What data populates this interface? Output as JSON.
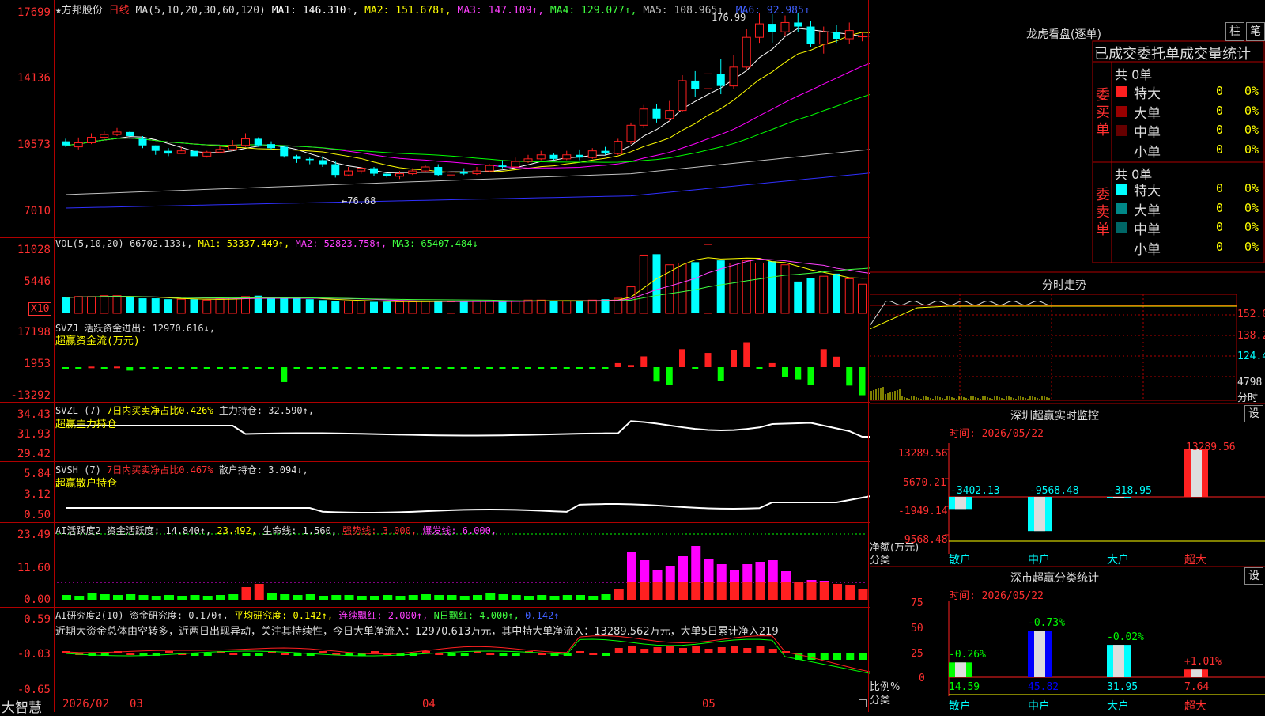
{
  "app": {
    "name": "大智慧"
  },
  "stock": {
    "name": "★方邦股份",
    "period": "日线"
  },
  "main": {
    "ma_label": "MA(5,10,20,30,60,120)",
    "ma1": "MA1: 146.310↑,",
    "ma2": "MA2: 151.678↑,",
    "ma3": "MA3: 147.109↑,",
    "ma4": "MA4: 129.077↑,",
    "ma5": "MA5: 108.965↑,",
    "ma6": "MA6: 92.985↑",
    "yticks": [
      "17699",
      "14136",
      "10573",
      "7010"
    ],
    "high_mark": "176.99",
    "low_mark": "←76.68",
    "colors": {
      "ma1": "#ffffff",
      "ma2": "#ffff00",
      "ma3": "#ff00ff",
      "ma4": "#00ff00",
      "ma5": "#c0c0c0",
      "ma6": "#3030ff",
      "up": "#ff2020",
      "down": "#00ffff"
    }
  },
  "candles": [
    [
      106.6,
      104.4,
      108.0,
      103.6
    ],
    [
      103.6,
      105.8,
      108.7,
      102.2
    ],
    [
      105.8,
      108.8,
      111.0,
      105.1
    ],
    [
      108.8,
      110.3,
      112.5,
      107.3
    ],
    [
      110.3,
      111.7,
      113.9,
      109.5
    ],
    [
      111.7,
      109.5,
      112.5,
      108.0
    ],
    [
      108.0,
      104.4,
      109.5,
      102.9
    ],
    [
      104.4,
      101.4,
      104.4,
      99.2
    ],
    [
      101.4,
      99.9,
      102.9,
      98.5
    ],
    [
      99.9,
      101.4,
      103.6,
      99.9
    ],
    [
      101.4,
      98.5,
      102.2,
      96.3
    ],
    [
      98.5,
      100.7,
      101.4,
      97.7
    ],
    [
      100.7,
      102.2,
      104.4,
      100.0
    ],
    [
      102.2,
      104.4,
      107.3,
      101.4
    ],
    [
      104.4,
      108.0,
      111.0,
      103.6
    ],
    [
      108.0,
      104.4,
      108.8,
      103.6
    ],
    [
      105.1,
      102.9,
      106.6,
      102.2
    ],
    [
      103.6,
      98.5,
      104.4,
      97.7
    ],
    [
      98.5,
      97.0,
      99.2,
      94.8
    ],
    [
      97.0,
      96.3,
      97.7,
      94.1
    ],
    [
      96.3,
      94.1,
      98.5,
      92.6
    ],
    [
      94.1,
      88.2,
      95.6,
      86.8
    ],
    [
      88.2,
      90.4,
      92.6,
      87.5
    ],
    [
      90.4,
      91.9,
      92.6,
      88.9
    ],
    [
      91.9,
      88.9,
      92.6,
      87.5
    ],
    [
      88.9,
      87.5,
      89.7,
      86.8
    ],
    [
      87.5,
      88.9,
      90.4,
      86.0
    ],
    [
      88.9,
      90.4,
      91.9,
      88.2
    ],
    [
      90.4,
      92.6,
      93.4,
      89.7
    ],
    [
      92.6,
      88.2,
      94.1,
      87.5
    ],
    [
      88.2,
      89.7,
      90.4,
      87.5
    ],
    [
      89.7,
      88.9,
      91.9,
      88.2
    ],
    [
      88.9,
      90.4,
      92.6,
      88.2
    ],
    [
      90.4,
      93.4,
      94.1,
      89.7
    ],
    [
      93.4,
      92.6,
      96.3,
      91.9
    ],
    [
      92.6,
      95.6,
      97.7,
      91.9
    ],
    [
      95.6,
      97.0,
      99.2,
      94.8
    ],
    [
      97.0,
      99.2,
      101.4,
      96.3
    ],
    [
      99.2,
      97.0,
      99.9,
      96.3
    ],
    [
      97.0,
      99.2,
      101.4,
      96.3
    ],
    [
      99.2,
      97.7,
      102.2,
      96.3
    ],
    [
      97.7,
      101.4,
      102.9,
      97.0
    ],
    [
      101.4,
      99.9,
      103.6,
      99.2
    ],
    [
      99.9,
      106.6,
      108.0,
      99.2
    ],
    [
      106.6,
      115.4,
      116.9,
      105.1
    ],
    [
      115.4,
      124.3,
      126.5,
      113.9
    ],
    [
      124.3,
      119.1,
      127.2,
      116.9
    ],
    [
      119.1,
      123.5,
      128.7,
      117.7
    ],
    [
      123.5,
      139.8,
      142.8,
      122.8
    ],
    [
      139.8,
      135.4,
      145.0,
      131.0
    ],
    [
      135.4,
      143.5,
      146.5,
      131.7
    ],
    [
      143.5,
      136.9,
      151.6,
      132.4
    ],
    [
      136.9,
      147.2,
      153.8,
      135.4
    ],
    [
      147.2,
      163.5,
      167.9,
      145.7
    ],
    [
      163.5,
      170.9,
      176.8,
      160.5
    ],
    [
      170.9,
      166.5,
      176.2,
      160.6
    ],
    [
      166.5,
      171.6,
      175.4,
      164.2
    ],
    [
      171.6,
      169.4,
      176.9,
      166.5
    ],
    [
      169.4,
      159.8,
      172.4,
      158.3
    ],
    [
      159.8,
      166.5,
      169.4,
      154.6
    ],
    [
      166.5,
      162.7,
      170.1,
      160.5
    ],
    [
      162.7,
      167.2,
      171.6,
      159.8
    ],
    [
      164.2,
      164.2,
      166.5,
      161.3
    ],
    [
      166.5,
      160.5,
      168.7,
      158.3
    ],
    [
      160.5,
      151.6,
      162.7,
      149.4
    ],
    [
      151.6,
      147.2,
      155.3,
      144.3
    ],
    [
      147.2,
      148.7,
      151.6,
      143.5
    ],
    [
      148.7,
      149.4,
      152.3,
      146.5
    ],
    [
      149.4,
      142.8,
      153.1,
      142.8
    ],
    [
      142.8,
      163.5,
      164.2,
      142.8
    ]
  ],
  "vol": {
    "label": "VOL(5,10,20)",
    "v": "66702.133↓,",
    "ma1": "MA1: 53337.449↑,",
    "ma2": "MA2: 52823.758↑,",
    "ma3": "MA3: 65407.484↓",
    "yticks": [
      "11028",
      "5446"
    ],
    "unit": "X10",
    "values": [
      18,
      19,
      19,
      20,
      20,
      18,
      17,
      17,
      16,
      16,
      16,
      15,
      16,
      17,
      19,
      20,
      18,
      17,
      17,
      16,
      15,
      14,
      14,
      14,
      13,
      13,
      13,
      13,
      14,
      14,
      13,
      13,
      14,
      14,
      13,
      14,
      15,
      15,
      14,
      14,
      14,
      15,
      16,
      17,
      30,
      66,
      67,
      55,
      57,
      58,
      78,
      60,
      57,
      60,
      57,
      59,
      55,
      36,
      40,
      42,
      45,
      39,
      33,
      41,
      36,
      30,
      31,
      35,
      48,
      46
    ]
  },
  "svzj": {
    "label": "SVZJ  活跃资金进出: 12970.616↓,",
    "sub": "超赢资金流(万元)",
    "yticks": [
      "17198",
      "1953",
      "-13292"
    ],
    "values": [
      -800,
      -600,
      200,
      -500,
      200,
      -1300,
      -600,
      -400,
      -400,
      -300,
      -500,
      -300,
      -300,
      -400,
      -300,
      -600,
      -600,
      -5600,
      -300,
      -400,
      -400,
      -300,
      -300,
      -300,
      -300,
      -400,
      -200,
      -300,
      -200,
      -400,
      -300,
      -300,
      -300,
      -200,
      -300,
      -300,
      -200,
      -300,
      -300,
      -400,
      -300,
      -400,
      -300,
      1500,
      800,
      4000,
      -5400,
      -6500,
      6700,
      -200,
      5300,
      -5100,
      6300,
      9300,
      -300,
      1500,
      -3700,
      -4600,
      -6800,
      6700,
      3900,
      -6900,
      -10500,
      -5500,
      -4800,
      -1800,
      3100,
      12900,
      10400
    ]
  },
  "svzl": {
    "label": "SVZL (7)",
    "pct": "7日内买卖净占比0.426%",
    "hold": "主力持仓: 32.590↑,",
    "sub": "超赢主力持仓",
    "yticks": [
      "34.43",
      "31.93",
      "29.42"
    ]
  },
  "svsh": {
    "label": "SVSH (7)",
    "pct": "7日内买卖净占比0.467%",
    "hold": "散户持仓: 3.094↓,",
    "sub": "超赢散户持仓",
    "yticks": [
      "5.84",
      "3.12",
      "0.50"
    ]
  },
  "ai1": {
    "label": "AI活跃度2",
    "a": "资金活跃度: 14.840↑,",
    "b": "23.492,",
    "c": "生命线: 1.560,",
    "d": "强势线: 3.000,",
    "e": "爆发线: 6.000,",
    "yticks": [
      "23.49",
      "11.60",
      "0.00"
    ]
  },
  "ai2": {
    "label": "AI研究度2(10)",
    "a": "资金研究度: 0.170↑,",
    "b": "平均研究度: 0.142↑,",
    "c": "连续飘红: 2.000↑,",
    "d": "N日飘红: 4.000↑,",
    "e": "0.142↑",
    "note": "近期大资金总体由空转多，近两日出现异动，关注其持续性，今日大单净流入：12970.613万元，其中特大单净流入：13289.562万元，大单5日累计净入219",
    "yticks": [
      "0.59",
      "-0.03",
      "-0.65"
    ]
  },
  "timeaxis": [
    "2026/02",
    "03",
    "04",
    "05"
  ],
  "lhb": {
    "title": "龙虎看盘(逐单)",
    "btn1": "柱",
    "btn2": "笔",
    "header": "已成交委托单成交量统计",
    "buy_label": "委买单",
    "sell_label": "委卖单",
    "buy_total": "共 0单",
    "sell_total": "共 0单",
    "buy_rows": [
      [
        "特大",
        "0",
        "0%"
      ],
      [
        "大单",
        "0",
        "0%"
      ],
      [
        "中单",
        "0",
        "0%"
      ],
      [
        "小单",
        "0",
        "0%"
      ]
    ],
    "sell_rows": [
      [
        "特大",
        "0",
        "0%"
      ],
      [
        "大单",
        "0",
        "0%"
      ],
      [
        "中单",
        "0",
        "0%"
      ],
      [
        "小单",
        "0",
        "0%"
      ]
    ]
  },
  "fenshi": {
    "title": "分时走势",
    "yticks": [
      "152.0",
      "138.2",
      "124.4",
      "4798"
    ],
    "unit": "分时"
  },
  "szmon": {
    "title": "深圳超赢实时监控",
    "btn": "设",
    "time": "时间: 2026/05/22",
    "yticks": [
      "13289.56",
      "5670.21",
      "-1949.14",
      "-9568.48"
    ],
    "ylabel": "净额(万元)",
    "xcat_label": "分类",
    "cats": [
      "散户",
      "中户",
      "大户",
      "超大"
    ],
    "values": [
      -3402.13,
      -9568.48,
      -318.95,
      13289.56
    ],
    "labels": [
      "-3402.13",
      "-9568.48",
      "-318.95",
      "13289.56"
    ]
  },
  "szcls": {
    "title": "深市超赢分类统计",
    "btn": "设",
    "time": "时间: 2026/05/22",
    "yticks": [
      "75",
      "50",
      "25",
      "0"
    ],
    "ylabel": "比例%",
    "xcat_label": "分类",
    "cats": [
      "散户",
      "中户",
      "大户",
      "超大"
    ],
    "values": [
      14.59,
      45.82,
      31.95,
      7.64
    ],
    "values_text": [
      "14.59",
      "45.82",
      "31.95",
      "7.64"
    ],
    "changes": [
      "-0.26%",
      "-0.73%",
      "-0.02%",
      "+1.01%"
    ]
  }
}
